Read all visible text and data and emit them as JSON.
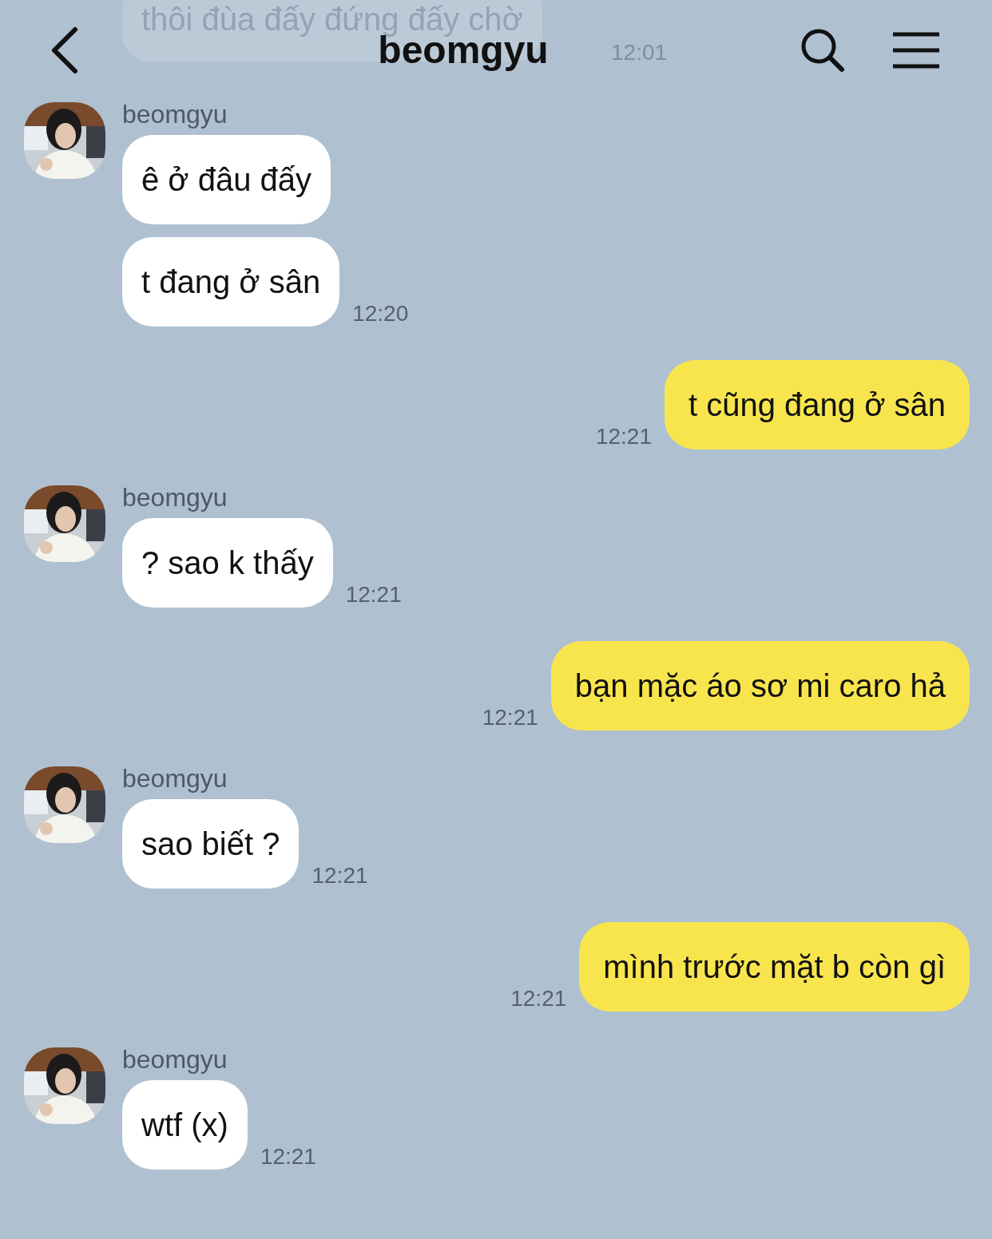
{
  "header": {
    "title": "beomgyu"
  },
  "faded_message": {
    "text": "thôi đùa đấy đứng đấy chờ",
    "time": "12:01"
  },
  "messages": [
    {
      "kind": "received",
      "sender": "beomgyu",
      "bubbles": [
        "ê ở đâu đấy",
        "t đang ở sân"
      ],
      "time": "12:20"
    },
    {
      "kind": "sent",
      "bubbles": [
        "t cũng đang ở sân"
      ],
      "time": "12:21"
    },
    {
      "kind": "received",
      "sender": "beomgyu",
      "bubbles": [
        "? sao k thấy"
      ],
      "time": "12:21"
    },
    {
      "kind": "sent",
      "bubbles": [
        "bạn mặc áo sơ mi caro hả"
      ],
      "time": "12:21"
    },
    {
      "kind": "received",
      "sender": "beomgyu",
      "bubbles": [
        "sao biết ?"
      ],
      "time": "12:21"
    },
    {
      "kind": "sent",
      "bubbles": [
        "mình trước mặt b còn gì"
      ],
      "time": "12:21"
    },
    {
      "kind": "received",
      "sender": "beomgyu",
      "bubbles": [
        "wtf (x)"
      ],
      "time": "12:21"
    }
  ]
}
